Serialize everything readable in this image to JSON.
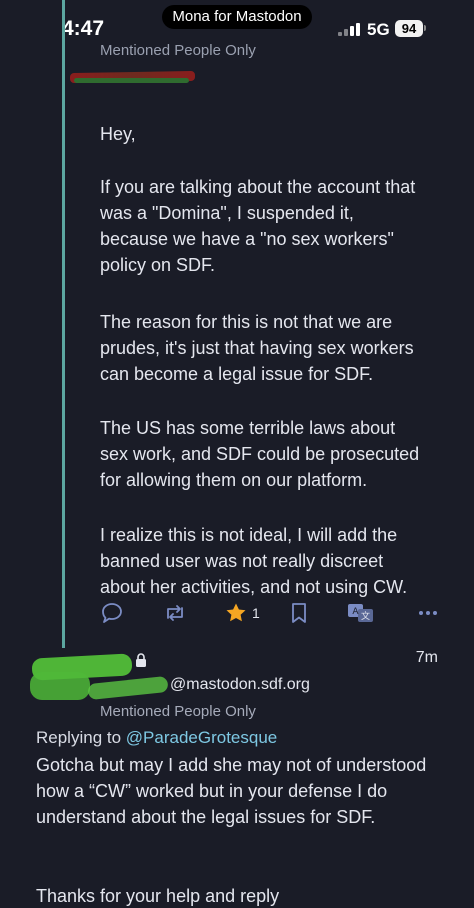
{
  "status_bar": {
    "time": "4:47",
    "app_pill": "Mona for Mastodon",
    "network": "5G",
    "battery": "94"
  },
  "post_top": {
    "visibility": "Mentioned People Only",
    "paragraphs": [
      "Hey,",
      "If you are talking about the account that\nwas a \"Domina\", I suspended it,\nbecause we have a  \"no sex workers\"\npolicy on SDF.",
      "The reason for this is not that we are\nprudes, it's just that having sex workers\ncan become a legal issue for SDF.",
      "The US has some terrible laws about\nsex work, and SDF could be prosecuted\nfor allowing them on our platform.",
      "I realize this is not ideal, I will add the\nbanned user was not really discreet\nabout her activities, and not using CW."
    ],
    "actions": {
      "reply_icon": "speech-bubble-icon",
      "boost_icon": "boost-arrows-icon",
      "favorite_icon": "star-icon",
      "favorite_count": "1",
      "bookmark_icon": "bookmark-icon",
      "translate_icon": "translate-icon",
      "more_icon": "ellipsis-icon"
    },
    "accent_color": "#5ca6a0",
    "star_color": "#f5a623"
  },
  "post_reply": {
    "handle": "@mastodon.sdf.org",
    "time": "7m",
    "visibility": "Mentioned People Only",
    "replying_prefix": "Replying to",
    "replying_to": "@ParadeGrotesque",
    "body": "Gotcha but may I add she may not of understood how a “CW” worked but in your defense I do understand about the legal issues for SDF.",
    "thanks": "Thanks for your help and reply",
    "mention_color": "#7ec8e3"
  }
}
